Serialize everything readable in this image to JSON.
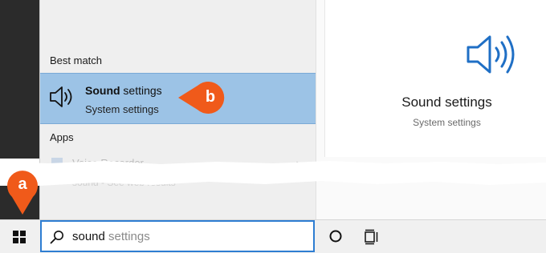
{
  "results": {
    "best_match_label": "Best match",
    "best_match": {
      "title_bold": "Sound",
      "title_rest": " settings",
      "subtitle": "System settings",
      "icon": "speaker-icon"
    },
    "apps_label": "Apps",
    "apps_items": [
      {
        "label": "Voice Recorder",
        "icon": "voice-recorder-icon"
      }
    ],
    "web_item": "sound - See web results"
  },
  "preview": {
    "title": "Sound settings",
    "subtitle": "System settings",
    "icon": "speaker-icon"
  },
  "taskbar": {
    "start_icon": "windows-logo-icon",
    "search_icon": "search-icon",
    "search_typed": "sound",
    "search_suggestion": " settings",
    "cortana_icon": "cortana-circle-icon",
    "task_view_icon": "task-view-icon"
  },
  "callouts": {
    "a": "a",
    "b": "b",
    "color": "#f05a1a"
  }
}
